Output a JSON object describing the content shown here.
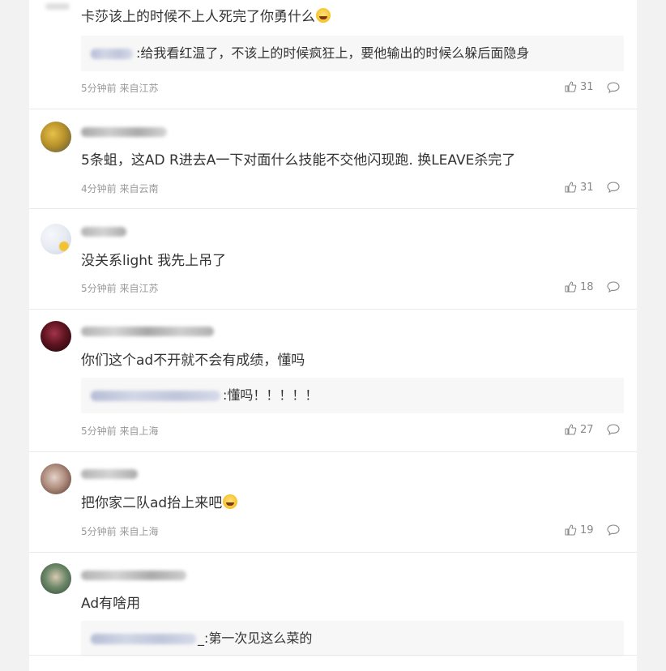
{
  "comments": [
    {
      "text": "卡莎该上的时候不上人死完了你勇什么",
      "emoji": "laugh-cry-emoji",
      "reply_text": ":给我看红温了，不该上的时候疯狂上，要他输出的时候么躲后面隐身",
      "meta": "5分钟前 来自江苏",
      "likes": "31"
    },
    {
      "text": "5条蛆，这AD R进去A一下对面什么技能不交他闪现跑. 换LEAVE杀完了",
      "meta": "4分钟前 来自云南",
      "likes": "31"
    },
    {
      "text": "没关系light 我先上吊了",
      "meta": "5分钟前 来自江苏",
      "likes": "18"
    },
    {
      "text": "你们这个ad不开就不会有成绩，懂吗",
      "reply_text": ":懂吗！！！！！",
      "meta": "5分钟前 来自上海",
      "likes": "27"
    },
    {
      "text": "把你家二队ad抬上来吧",
      "emoji": "laugh-cry-emoji",
      "meta": "5分钟前 来自上海",
      "likes": "19"
    },
    {
      "text": "Ad有啥用",
      "reply_text": "_:第一次见这么菜的"
    }
  ]
}
